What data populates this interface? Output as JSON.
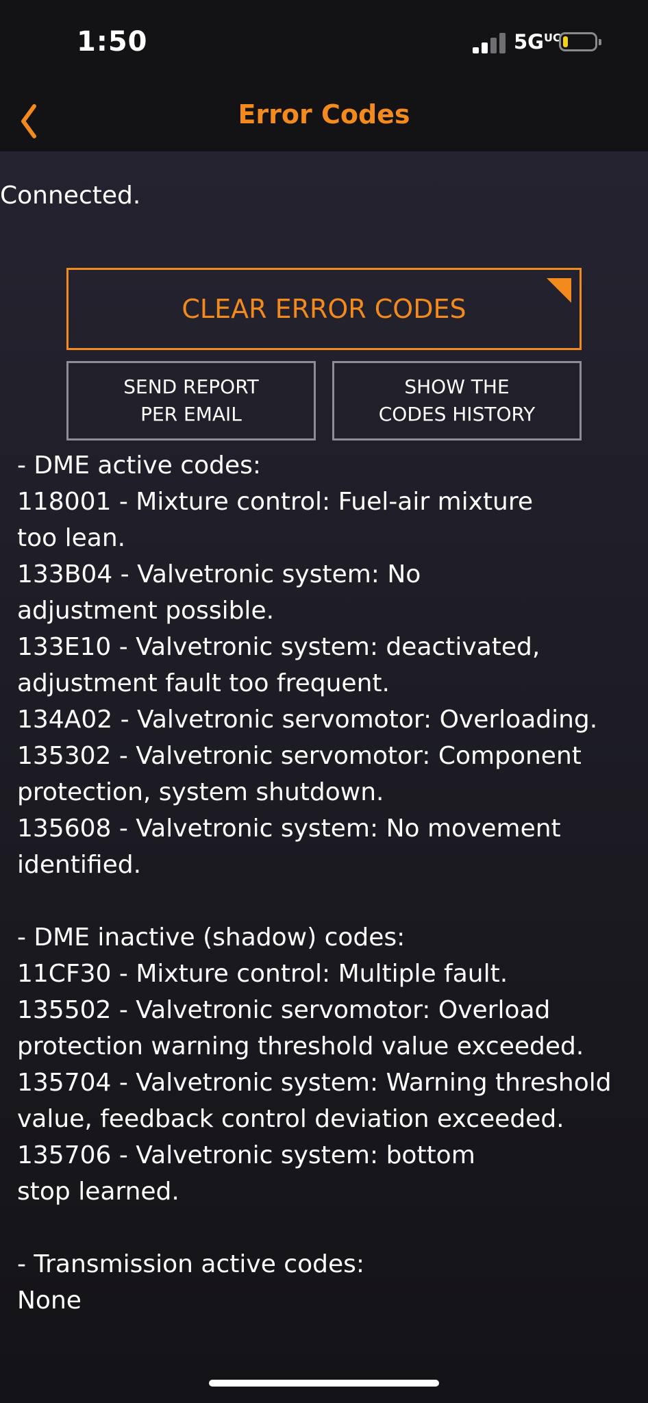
{
  "status_bar": {
    "time": "1:50",
    "network": "5G",
    "network_suffix": "UC",
    "signal_bars_active": 2,
    "signal_bars_total": 4,
    "battery_level": 0.15,
    "battery_color": "#f3d21c"
  },
  "nav": {
    "back_icon": "chevron-left-icon",
    "title": "Error Codes",
    "accent_color": "#f28a1d"
  },
  "connection": {
    "status": "Connected."
  },
  "actions": {
    "clear_label": "CLEAR ERROR CODES",
    "send_label_line1": "SEND REPORT",
    "send_label_line2": "PER EMAIL",
    "history_label_line1": "SHOW THE",
    "history_label_line2": "CODES HISTORY"
  },
  "report": {
    "dme_active": {
      "header": "- DME active codes:",
      "lines": [
        "118001 - Mixture control: Fuel-air mixture",
        "too lean.",
        "133B04 - Valvetronic system: No",
        "adjustment possible.",
        "133E10 - Valvetronic system: deactivated,",
        "adjustment fault too frequent.",
        "134A02 - Valvetronic servomotor: Overloading.",
        "135302 - Valvetronic servomotor: Component",
        "protection, system shutdown.",
        "135608 - Valvetronic system: No movement",
        "identified."
      ]
    },
    "dme_inactive": {
      "header": "- DME inactive (shadow) codes:",
      "lines": [
        "11CF30 - Mixture control: Multiple fault.",
        "135502 - Valvetronic servomotor: Overload",
        "protection warning threshold value exceeded.",
        "135704 - Valvetronic system: Warning threshold",
        "value, feedback control deviation exceeded.",
        "135706 - Valvetronic system: bottom",
        "stop learned."
      ]
    },
    "transmission_active": {
      "header": "- Transmission active codes:",
      "lines": [
        "None"
      ]
    }
  }
}
